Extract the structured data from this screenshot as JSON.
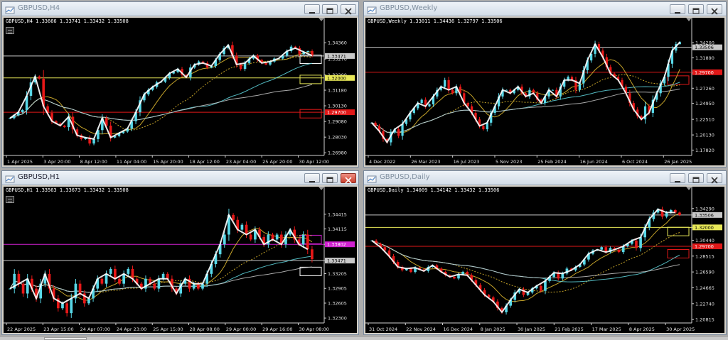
{
  "windows": [
    {
      "id": "h4",
      "title": "GBPUSD,H4",
      "info": "GBPUSD,H4  1.33666 1.33741 1.33432 1.33508",
      "chart_data": {
        "type": "candlestick",
        "ylim": [
          1.268,
          1.348
        ],
        "close": [
          1.293,
          1.295,
          1.297,
          1.2985,
          1.308,
          1.317,
          1.321,
          1.3195,
          1.301,
          1.2965,
          1.291,
          1.2895,
          1.288,
          1.287,
          1.294,
          1.2855,
          1.2815,
          1.279,
          1.28,
          1.276,
          1.279,
          1.285,
          1.293,
          1.288,
          1.28,
          1.281,
          1.283,
          1.284,
          1.286,
          1.291,
          1.297,
          1.305,
          1.309,
          1.312,
          1.314,
          1.317,
          1.3175,
          1.32,
          1.323,
          1.324,
          1.326,
          1.322,
          1.3205,
          1.327,
          1.329,
          1.331,
          1.33,
          1.327,
          1.328,
          1.332,
          1.336,
          1.34,
          1.342,
          1.335,
          1.329,
          1.326,
          1.33,
          1.333,
          1.335,
          1.332,
          1.33,
          1.329,
          1.331,
          1.333,
          1.333,
          1.335,
          1.338,
          1.341,
          1.34,
          1.336,
          1.3375,
          1.338,
          1.335
        ],
        "price_labels": [
          "1.34360",
          "1.33270",
          "1.32200",
          "1.31180",
          "1.30130",
          "1.29080",
          "1.28030",
          "1.26980"
        ],
        "price_values": [
          1.3436,
          1.3327,
          1.322,
          1.3118,
          1.3013,
          1.2908,
          1.2803,
          1.2698
        ],
        "time_labels": [
          "1 Apr 2025",
          "3 Apr 20:00",
          "8 Apr 12:00",
          "11 Apr 04:00",
          "15 Apr 20:00",
          "18 Apr 12:00",
          "23 Apr 04:00",
          "25 Apr 20:00",
          "30 Apr 12:00"
        ],
        "hlines": [
          {
            "value": 1.33471,
            "color": "#c8c8c8",
            "label": "1.33471"
          },
          {
            "value": 1.32,
            "color": "#e8e858",
            "label": "1.32000"
          },
          {
            "value": 1.297,
            "color": "#e01818",
            "label": "1.29700"
          }
        ],
        "boxes": [
          {
            "value": 1.3325,
            "color": "#ffffff"
          },
          {
            "value": 1.319,
            "color": "#e8e858"
          },
          {
            "value": 1.296,
            "color": "#e01818"
          }
        ]
      }
    },
    {
      "id": "weekly",
      "title": "GBPUSD,Weekly",
      "info": "GBPUSD,Weekly  1.33011 1.34436 1.32797 1.33506",
      "chart_data": {
        "type": "candlestick",
        "ylim": [
          1.17,
          1.352
        ],
        "close": [
          1.22,
          1.215,
          1.207,
          1.195,
          1.19,
          1.205,
          1.21,
          1.2,
          1.218,
          1.225,
          1.235,
          1.242,
          1.25,
          1.255,
          1.245,
          1.248,
          1.26,
          1.27,
          1.275,
          1.285,
          1.27,
          1.265,
          1.275,
          1.265,
          1.25,
          1.245,
          1.235,
          1.225,
          1.215,
          1.21,
          1.22,
          1.235,
          1.245,
          1.26,
          1.27,
          1.27,
          1.265,
          1.27,
          1.275,
          1.265,
          1.26,
          1.27,
          1.265,
          1.255,
          1.25,
          1.26,
          1.27,
          1.27,
          1.26,
          1.275,
          1.285,
          1.29,
          1.285,
          1.27,
          1.28,
          1.3,
          1.315,
          1.325,
          1.34,
          1.33,
          1.32,
          1.305,
          1.295,
          1.29,
          1.285,
          1.275,
          1.265,
          1.25,
          1.24,
          1.23,
          1.225,
          1.245,
          1.235,
          1.255,
          1.265,
          1.28,
          1.29,
          1.31,
          1.33,
          1.34,
          1.343
        ],
        "price_labels": [
          "1.34200",
          "1.31890",
          "1.29580",
          "1.27260",
          "1.24950",
          "1.22510",
          "1.20130",
          "1.17820"
        ],
        "price_values": [
          1.342,
          1.3189,
          1.2958,
          1.2726,
          1.2495,
          1.2251,
          1.2013,
          1.1782
        ],
        "time_labels": [
          "4 Dec 2022",
          "26 Mar 2023",
          "16 Jul 2023",
          "5 Nov 2023",
          "25 Feb 2024",
          "16 Jun 2024",
          "6 Oct 2024",
          "26 Jan 2025"
        ],
        "hlines": [
          {
            "value": 1.33506,
            "color": "#c8c8c8",
            "label": "1.33506"
          },
          {
            "value": 1.297,
            "color": "#e01818",
            "label": "1.29700"
          }
        ],
        "boxes": [
          {
            "value": 1.285,
            "color": "#e01818"
          }
        ]
      }
    },
    {
      "id": "h1",
      "title": "GBPUSD,H1",
      "info": "GBPUSD,H1  1.33563 1.33673 1.33432 1.33508",
      "chart_data": {
        "type": "candlestick",
        "ylim": [
          1.322,
          1.346
        ],
        "close": [
          1.329,
          1.332,
          1.33,
          1.328,
          1.331,
          1.329,
          1.327,
          1.33,
          1.332,
          1.329,
          1.327,
          1.325,
          1.326,
          1.324,
          1.327,
          1.33,
          1.328,
          1.326,
          1.327,
          1.329,
          1.331,
          1.33,
          1.332,
          1.333,
          1.331,
          1.33,
          1.332,
          1.333,
          1.331,
          1.33,
          1.329,
          1.331,
          1.33,
          1.329,
          1.331,
          1.332,
          1.331,
          1.329,
          1.328,
          1.33,
          1.331,
          1.329,
          1.33,
          1.329,
          1.33,
          1.332,
          1.334,
          1.336,
          1.338,
          1.34,
          1.344,
          1.343,
          1.341,
          1.342,
          1.34,
          1.339,
          1.341,
          1.3395,
          1.338,
          1.34,
          1.339,
          1.34,
          1.338,
          1.34,
          1.341,
          1.339,
          1.338,
          1.34,
          1.337,
          1.335
        ],
        "price_labels": [
          "1.34415",
          "1.34115",
          "1.33802",
          "1.33471",
          "1.33205",
          "1.32905",
          "1.32605",
          "1.32300"
        ],
        "price_values": [
          1.34415,
          1.34115,
          1.33802,
          1.33471,
          1.33205,
          1.32905,
          1.32605,
          1.323
        ],
        "time_labels": [
          "22 Apr 2025",
          "23 Apr 15:00",
          "24 Apr 07:00",
          "24 Apr 23:00",
          "25 Apr 15:00",
          "28 Apr 08:00",
          "29 Apr 00:00",
          "29 Apr 16:00",
          "30 Apr 08:00"
        ],
        "hlines": [
          {
            "value": 1.33471,
            "color": "#c8c8c8",
            "label": "1.33471"
          },
          {
            "value": 1.33802,
            "color": "#d020d0",
            "label": "1.33802"
          }
        ],
        "boxes": [
          {
            "value": 1.339,
            "color": "#d020d0"
          },
          {
            "value": 1.3325,
            "color": "#ffffff"
          }
        ]
      }
    },
    {
      "id": "daily",
      "title": "GBPUSD,Daily",
      "info": "GBPUSD,Daily  1.34009 1.34142 1.33432 1.33506",
      "chart_data": {
        "type": "candlestick",
        "ylim": [
          1.204,
          1.347
        ],
        "close": [
          1.304,
          1.3,
          1.296,
          1.292,
          1.285,
          1.278,
          1.272,
          1.268,
          1.27,
          1.266,
          1.271,
          1.269,
          1.267,
          1.272,
          1.274,
          1.27,
          1.266,
          1.262,
          1.26,
          1.258,
          1.263,
          1.266,
          1.262,
          1.256,
          1.25,
          1.244,
          1.238,
          1.235,
          1.23,
          1.222,
          1.217,
          1.225,
          1.232,
          1.241,
          1.245,
          1.238,
          1.241,
          1.246,
          1.249,
          1.243,
          1.255,
          1.26,
          1.265,
          1.258,
          1.264,
          1.27,
          1.268,
          1.272,
          1.275,
          1.281,
          1.288,
          1.292,
          1.293,
          1.296,
          1.29,
          1.295,
          1.293,
          1.29,
          1.297,
          1.3,
          1.304,
          1.295,
          1.308,
          1.32,
          1.33,
          1.338,
          1.342,
          1.333,
          1.338,
          1.341,
          1.338,
          1.335
        ],
        "price_labels": [
          "1.34290",
          "1.33506",
          "1.32000",
          "1.30440",
          "1.28515",
          "1.26590",
          "1.24665",
          "1.22740",
          "1.20815"
        ],
        "price_values": [
          1.3429,
          1.33506,
          1.32,
          1.3044,
          1.28515,
          1.2659,
          1.24665,
          1.2274,
          1.20815
        ],
        "time_labels": [
          "31 Oct 2024",
          "22 Nov 2024",
          "16 Dec 2024",
          "8 Jan 2025",
          "30 Jan 2025",
          "21 Feb 2025",
          "17 Mar 2025",
          "8 Apr 2025",
          "30 Apr 2025"
        ],
        "hlines": [
          {
            "value": 1.33506,
            "color": "#c8c8c8",
            "label": "1.33506"
          },
          {
            "value": 1.32,
            "color": "#e8e858",
            "label": "1.32000"
          },
          {
            "value": 1.297,
            "color": "#e01818",
            "label": "1.29700"
          }
        ],
        "boxes": [
          {
            "value": 1.315,
            "color": "#e8e858"
          },
          {
            "value": 1.288,
            "color": "#e01818"
          }
        ]
      }
    }
  ]
}
